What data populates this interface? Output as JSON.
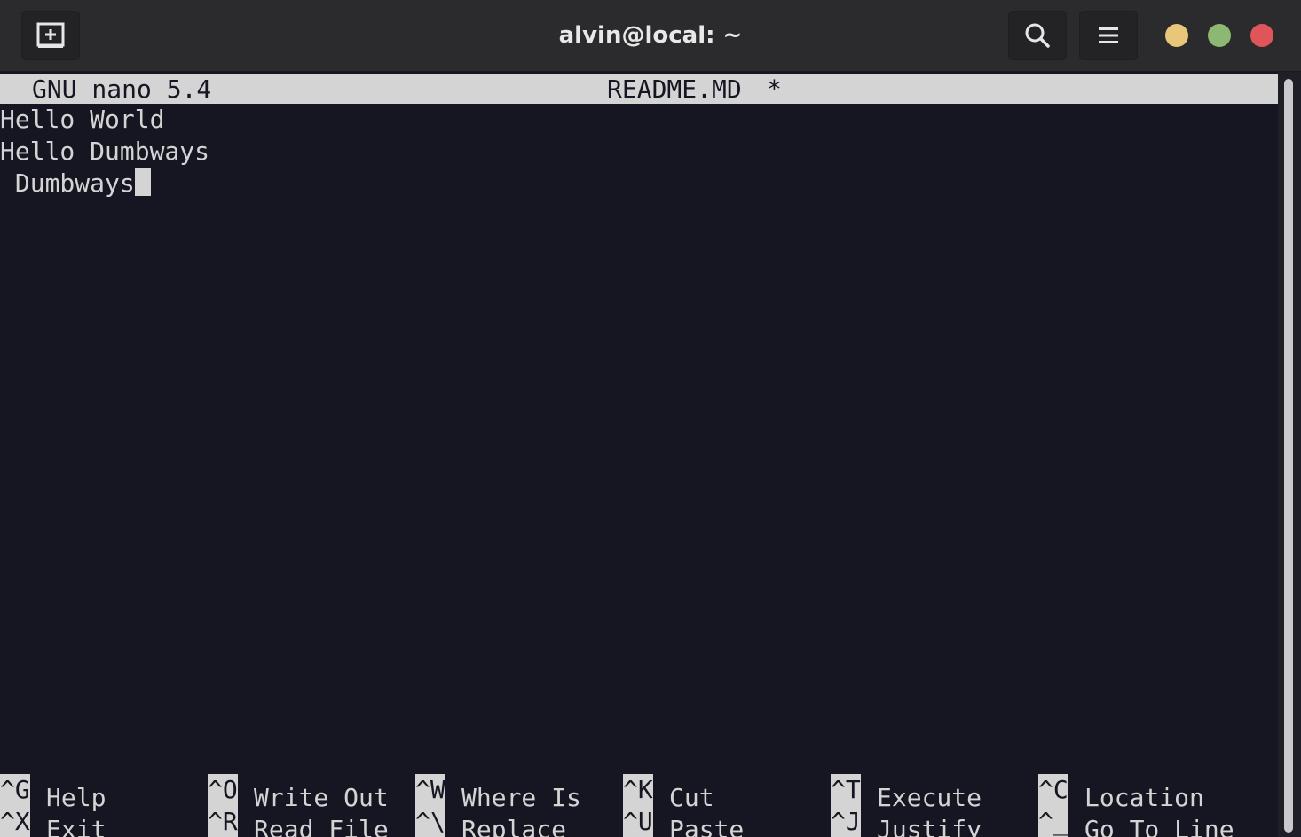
{
  "window": {
    "title": "alvin@local: ~",
    "new_tab_icon": "new-tab-icon",
    "search_icon": "search-icon",
    "menu_icon": "hamburger-menu-icon",
    "controls": {
      "minimize_color": "#e8c67a",
      "maximize_color": "#8db871",
      "close_color": "#e0555a"
    }
  },
  "nano": {
    "version_label": "GNU nano 5.4",
    "filename": "README.MD",
    "modified_marker": "*",
    "lines": [
      "Hello World",
      "Hello Dumbways",
      " Dumbways"
    ],
    "shortcuts_row1": [
      {
        "key": "^G",
        "label": "Help"
      },
      {
        "key": "^O",
        "label": "Write Out"
      },
      {
        "key": "^W",
        "label": "Where Is"
      },
      {
        "key": "^K",
        "label": "Cut"
      },
      {
        "key": "^T",
        "label": "Execute"
      },
      {
        "key": "^C",
        "label": "Location"
      }
    ],
    "shortcuts_row2": [
      {
        "key": "^X",
        "label": "Exit"
      },
      {
        "key": "^R",
        "label": "Read File"
      },
      {
        "key": "^\\",
        "label": "Replace"
      },
      {
        "key": "^U",
        "label": "Paste"
      },
      {
        "key": "^J",
        "label": "Justify"
      },
      {
        "key": "^_",
        "label": "Go To Line"
      }
    ]
  }
}
